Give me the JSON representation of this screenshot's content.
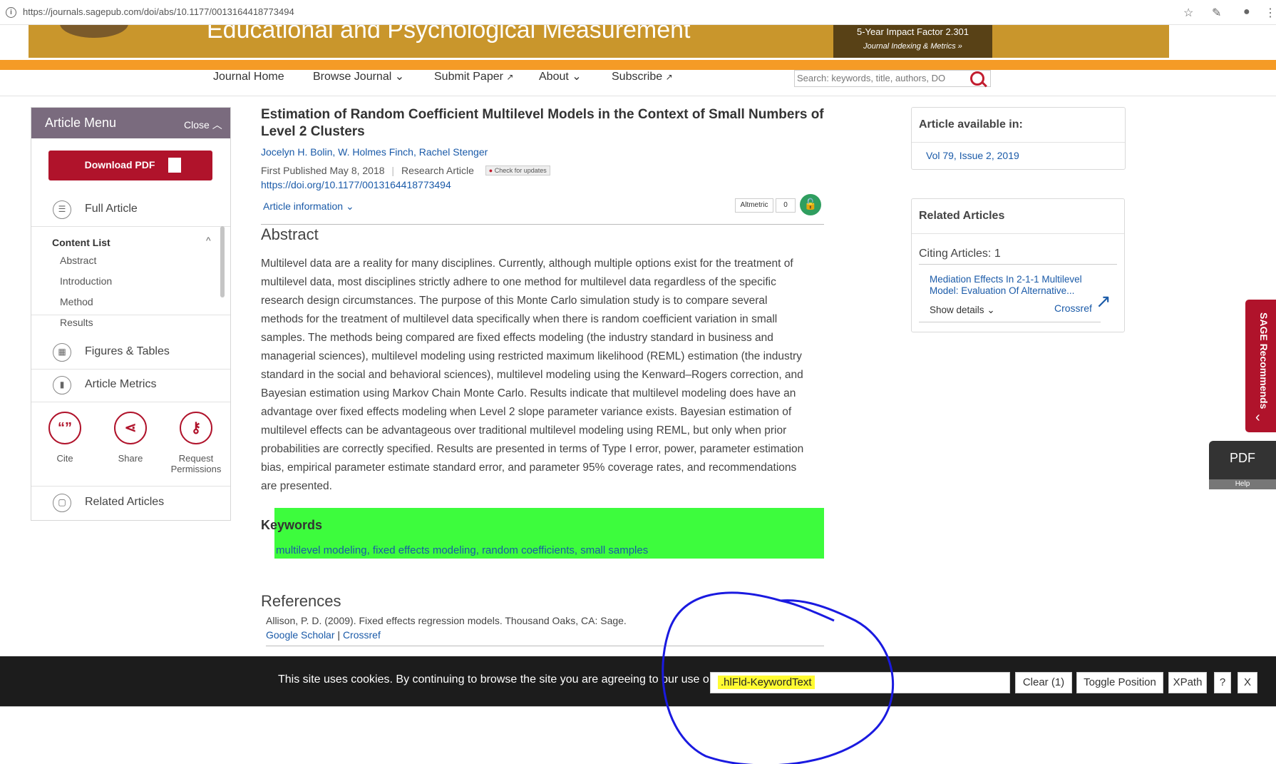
{
  "browser": {
    "url": "https://journals.sagepub.com/doi/abs/10.1177/0013164418773494"
  },
  "banner": {
    "journal_title": "Educational and Psychological Measurement",
    "impact_factor": "5-Year Impact Factor 2.301",
    "indexing_link": "Journal Indexing & Metrics »"
  },
  "nav": {
    "items": [
      "Journal Home",
      "Browse Journal",
      "Submit Paper",
      "About",
      "Subscribe"
    ],
    "search_placeholder": "Search: keywords, title, authors, DO"
  },
  "article_menu": {
    "title": "Article Menu",
    "close": "Close",
    "download_pdf": "Download PDF",
    "full_article": "Full Article",
    "content_list": "Content List",
    "content_items": [
      "Abstract",
      "Introduction",
      "Method",
      "Results"
    ],
    "figures_tables": "Figures & Tables",
    "article_metrics": "Article Metrics",
    "cite": "Cite",
    "share": "Share",
    "request_permissions_1": "Request",
    "request_permissions_2": "Permissions",
    "related_articles": "Related Articles"
  },
  "article": {
    "title": "Estimation of Random Coefficient Multilevel Models in the Context of Small Numbers of Level 2 Clusters",
    "authors": [
      "Jocelyn H. Bolin",
      "W. Holmes Finch",
      "Rachel Stenger"
    ],
    "first_published": "First Published May 8, 2018",
    "article_type": "Research Article",
    "check_updates": "Check for updates",
    "doi": "https://doi.org/10.1177/0013164418773494",
    "article_information": "Article information",
    "altmetric": "Altmetric",
    "altmetric_score": "0",
    "abstract_heading": "Abstract",
    "abstract_lines": [
      "Multilevel data are a reality for many disciplines. Currently, although multiple options exist for the treatment of",
      "multilevel data, most disciplines strictly adhere to one method for multilevel data regardless of the specific",
      "research design circumstances. The purpose of this Monte Carlo simulation study is to compare several",
      "methods for the treatment of multilevel data specifically when there is random coefficient variation in small",
      "samples. The methods being compared are fixed effects modeling (the industry standard in business and",
      "managerial sciences), multilevel modeling using restricted maximum likelihood (REML) estimation (the industry",
      "standard in the social and behavioral sciences), multilevel modeling using the Kenward–Rogers correction, and",
      "Bayesian estimation using Markov Chain Monte Carlo. Results indicate that multilevel modeling does have an",
      "advantage over fixed effects modeling when Level 2 slope parameter variance exists. Bayesian estimation of",
      "multilevel effects can be advantageous over traditional multilevel modeling using REML, but only when prior",
      "probabilities are correctly specified. Results are presented in terms of Type I error, power, parameter estimation",
      "bias, empirical parameter estimate standard error, and parameter 95% coverage rates, and recommendations",
      "are presented."
    ],
    "keywords_heading": "Keywords",
    "keywords": [
      "multilevel modeling",
      "fixed effects modeling",
      "random coefficients",
      "small samples"
    ],
    "references_heading": "References",
    "reference_1": "Allison, P. D. (2009). Fixed effects regression models. Thousand Oaks, CA: Sage.",
    "google_scholar": "Google Scholar",
    "crossref": "Crossref"
  },
  "sidebar": {
    "available_in_title": "Article available in:",
    "available_in_link": "Vol 79, Issue 2, 2019",
    "related_title": "Related Articles",
    "citing_articles": "Citing Articles: 1",
    "related_item_line1": "Mediation Effects In 2-1-1 Multilevel",
    "related_item_line2": "Model: Evaluation Of Alternative...",
    "show_details": "Show details",
    "crossref": "Crossref",
    "sage_recommends": "SAGE Recommends",
    "pdf_help_title": "PDF",
    "pdf_help_sub": "Help"
  },
  "cookie_bar": {
    "message": "This site uses cookies. By continuing to browse the site you are agreeing to our use o",
    "selector_value": ".hlFld-KeywordText",
    "clear_button": "Clear (1)",
    "toggle_button": "Toggle Position",
    "xpath_button": "XPath",
    "help_button": "?",
    "close_button": "X"
  },
  "colors": {
    "banner_gold": "#c9962c",
    "orange_bar": "#f59b26",
    "brand_red": "#b0132b",
    "link_blue": "#1a5aa8",
    "keyword_highlight": "#3dfc3d",
    "selector_highlight": "#fffb31",
    "annotation_blue": "#1a1ae0"
  }
}
